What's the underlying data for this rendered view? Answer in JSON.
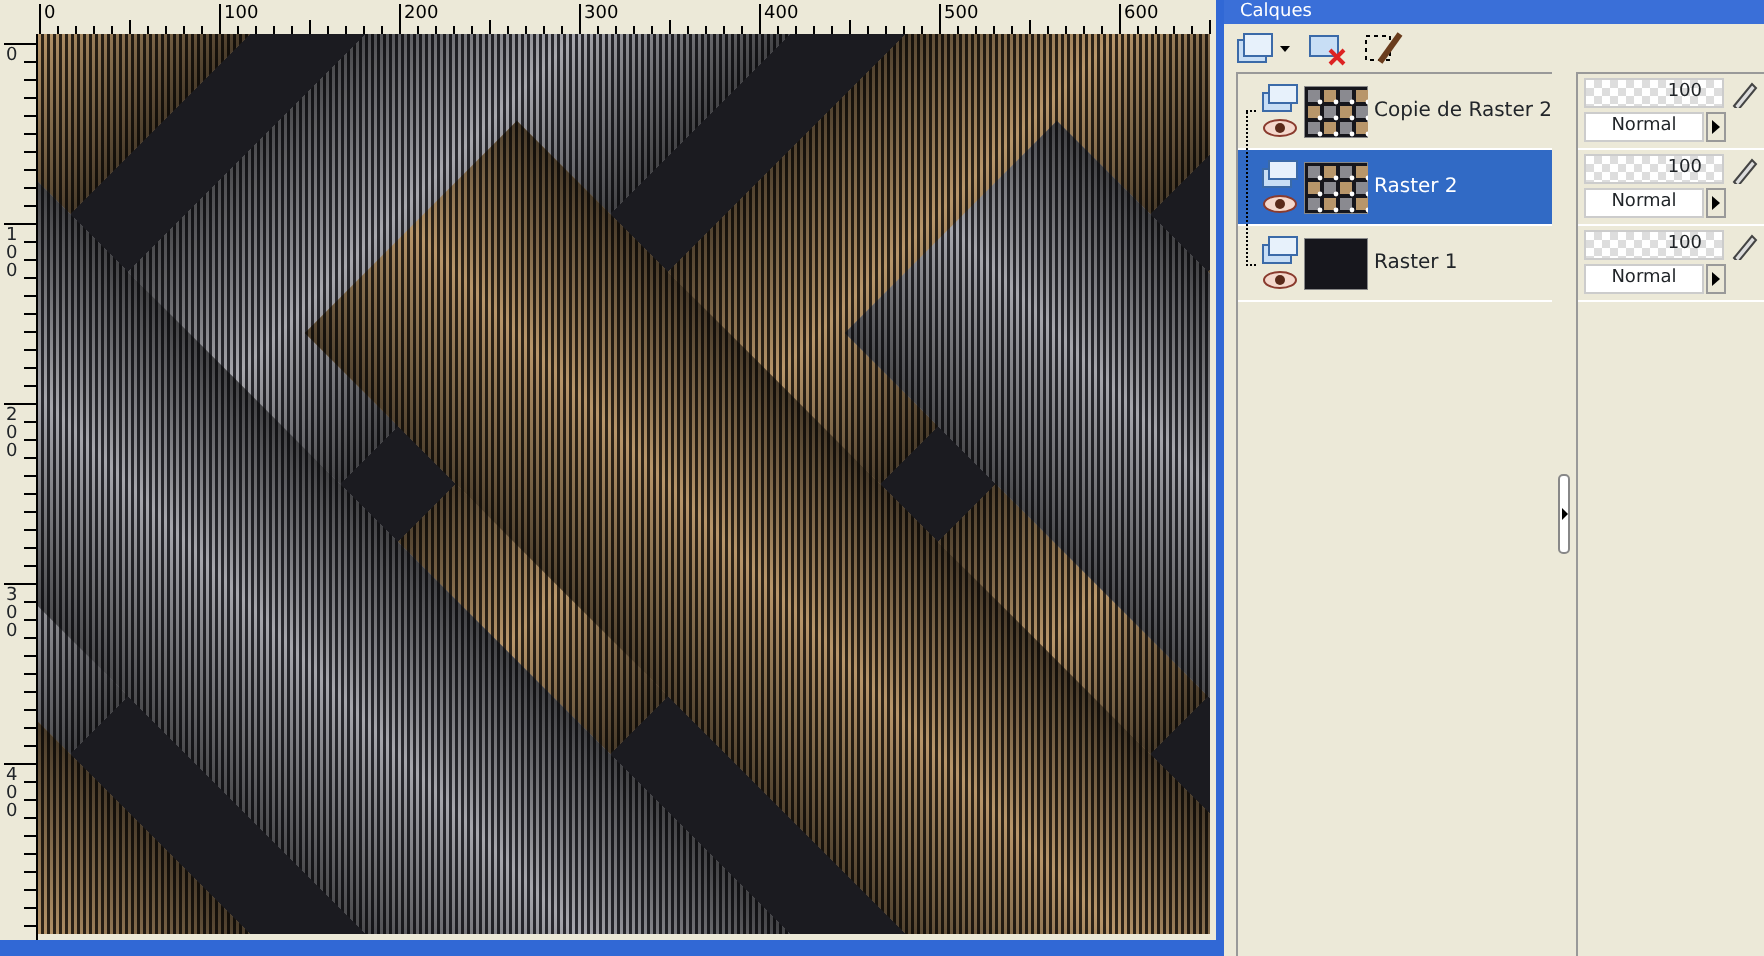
{
  "canvas": {
    "rulers": {
      "horizontal": [
        "0",
        "100",
        "200",
        "300",
        "400",
        "500",
        "600"
      ],
      "vertical": [
        "0",
        "100",
        "200",
        "300",
        "400"
      ]
    }
  },
  "palette": {
    "title": "Calques",
    "layers": [
      {
        "name": "Copie de Raster 2",
        "kind": "pattern",
        "selected": false,
        "visible": true,
        "opacity": "100",
        "blend": "Normal"
      },
      {
        "name": "Raster 2",
        "kind": "pattern",
        "selected": true,
        "visible": true,
        "opacity": "100",
        "blend": "Normal"
      },
      {
        "name": "Raster 1",
        "kind": "solid",
        "selected": false,
        "visible": true,
        "opacity": "100",
        "blend": "Normal"
      }
    ]
  }
}
